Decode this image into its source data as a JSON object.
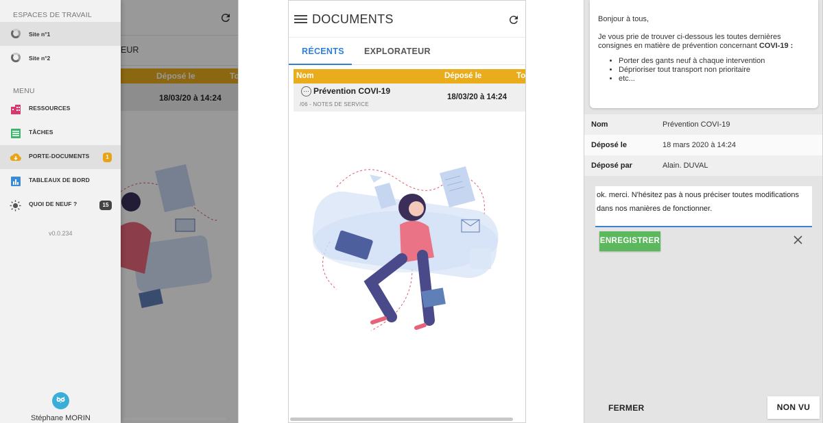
{
  "panel1": {
    "drawer": {
      "workspaces_title": "ESPACES DE TRAVAIL",
      "workspaces": [
        {
          "label": "Site n°1"
        },
        {
          "label": "Site n°2"
        }
      ],
      "menu_title": "MENU",
      "menu": [
        {
          "label": "RESSOURCES",
          "icon": "building-icon"
        },
        {
          "label": "TÂCHES",
          "icon": "tasks-icon"
        },
        {
          "label": "PORTE-DOCUMENTS",
          "icon": "cloud-download-icon",
          "badge": "1"
        },
        {
          "label": "TABLEAUX DE BORD",
          "icon": "bar-chart-icon"
        },
        {
          "label": "QUOI DE NEUF ?",
          "icon": "sun-icon",
          "badge": "15"
        }
      ],
      "version": "v0.0.234",
      "user_name": "Stéphane MORIN"
    },
    "underlay": {
      "tab_fragment": "EUR",
      "col_depose": "Déposé le",
      "col_to": "To",
      "row_date": "18/03/20 à 14:24"
    }
  },
  "panel2": {
    "title": "DOCUMENTS",
    "tabs": [
      "RÉCENTS",
      "EXPLORATEUR"
    ],
    "columns": [
      "Nom",
      "Déposé le",
      "To"
    ],
    "rows": [
      {
        "name": "Prévention COVI-19",
        "sub": "/06 - NOTES DE SERVICE",
        "date": "18/03/20 à 14:24"
      }
    ]
  },
  "panel3": {
    "message": {
      "greeting": "Bonjour à tous,",
      "intro": "Je vous prie de trouver ci-dessous les toutes dernières consignes en matière de prévention concernant",
      "intro_bold": "COVI-19 :",
      "bullets": [
        "Porter des gants neuf à chaque intervention",
        "Déprioriser tout transport non prioritaire",
        "etc..."
      ]
    },
    "details": [
      {
        "label": "Nom",
        "value": "Prévention COVI-19"
      },
      {
        "label": "Déposé le",
        "value": "18 mars 2020 à 14:24"
      },
      {
        "label": "Déposé par",
        "value": "Alain. DUVAL"
      }
    ],
    "comment": "ok. merci. N'hésitez pas à nous préciser toutes modifications dans nos manières de fonctionner.",
    "save_label": "ENREGISTRER",
    "close_label": "FERMER",
    "unseen_label": "NON VU"
  },
  "colors": {
    "accent_blue": "#2f7fd8",
    "table_header": "#e8ac1d",
    "save_green": "#5cb85c",
    "badge_orange": "#e8a317",
    "badge_dark": "#444444"
  }
}
